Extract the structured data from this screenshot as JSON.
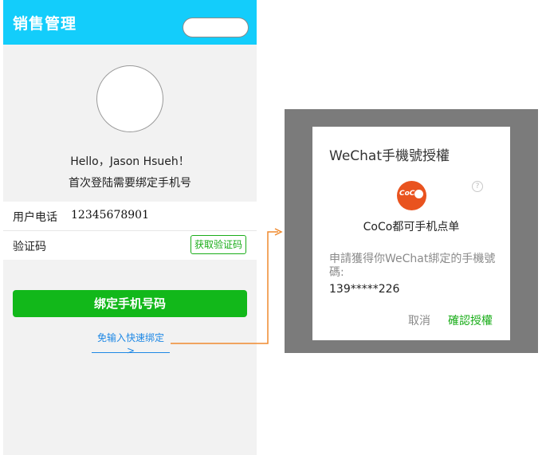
{
  "header": {
    "title": "销售管理"
  },
  "greeting": "Hello，Jason Hsueh！",
  "bind_prompt": "首次登陆需要绑定手机号",
  "form": {
    "phone_label": "用户电话",
    "phone_value": "12345678901",
    "code_label": "验证码",
    "code_button": "获取验证码"
  },
  "bind_button": "绑定手机号码",
  "quick_bind": {
    "label": "免输入快速绑定",
    "arrow": ">"
  },
  "dialog": {
    "title": "WeChat手機號授權",
    "logo_text": "CoCo",
    "help": "?",
    "app_name": "CoCo都可手机点单",
    "request": "申請獲得你WeChat綁定的手機號碼:",
    "phone": "139*****226",
    "cancel": "取消",
    "confirm": "確認授權"
  },
  "colors": {
    "header": "#13cdfb",
    "primary_green": "#1aad19",
    "link_blue": "#1e88e5",
    "connector_orange": "#ef8a2e",
    "overlay": "#7b7b7b",
    "logo_orange": "#e9531f"
  }
}
